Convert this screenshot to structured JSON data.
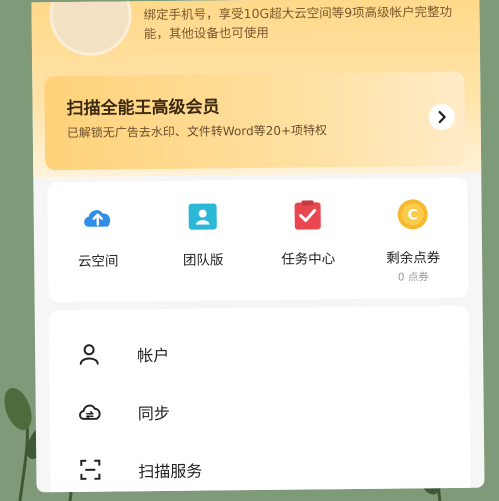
{
  "header": {
    "bind_phone_text": "绑定手机号，享受10G超大云空间等9项高级帐户完整功能，其他设备也可使用"
  },
  "vip": {
    "title": "扫描全能王高级会员",
    "subtitle": "已解锁无广告去水印、文件转Word等20+项特权",
    "arrow_icon": "chevron-right-icon"
  },
  "features": [
    {
      "label": "云空间",
      "icon": "cloud-upload-icon",
      "color": "#2f8fe8"
    },
    {
      "label": "团队版",
      "icon": "team-folder-icon",
      "color": "#2bb8d6"
    },
    {
      "label": "任务中心",
      "icon": "task-check-icon",
      "color": "#e8474f"
    },
    {
      "label": "剩余点券",
      "sub": "0 点券",
      "icon": "coin-icon",
      "color": "#f5b82e"
    }
  ],
  "menu": [
    {
      "label": "帐户",
      "icon": "user-icon"
    },
    {
      "label": "同步",
      "icon": "cloud-sync-icon"
    },
    {
      "label": "扫描服务",
      "icon": "scan-icon"
    }
  ]
}
